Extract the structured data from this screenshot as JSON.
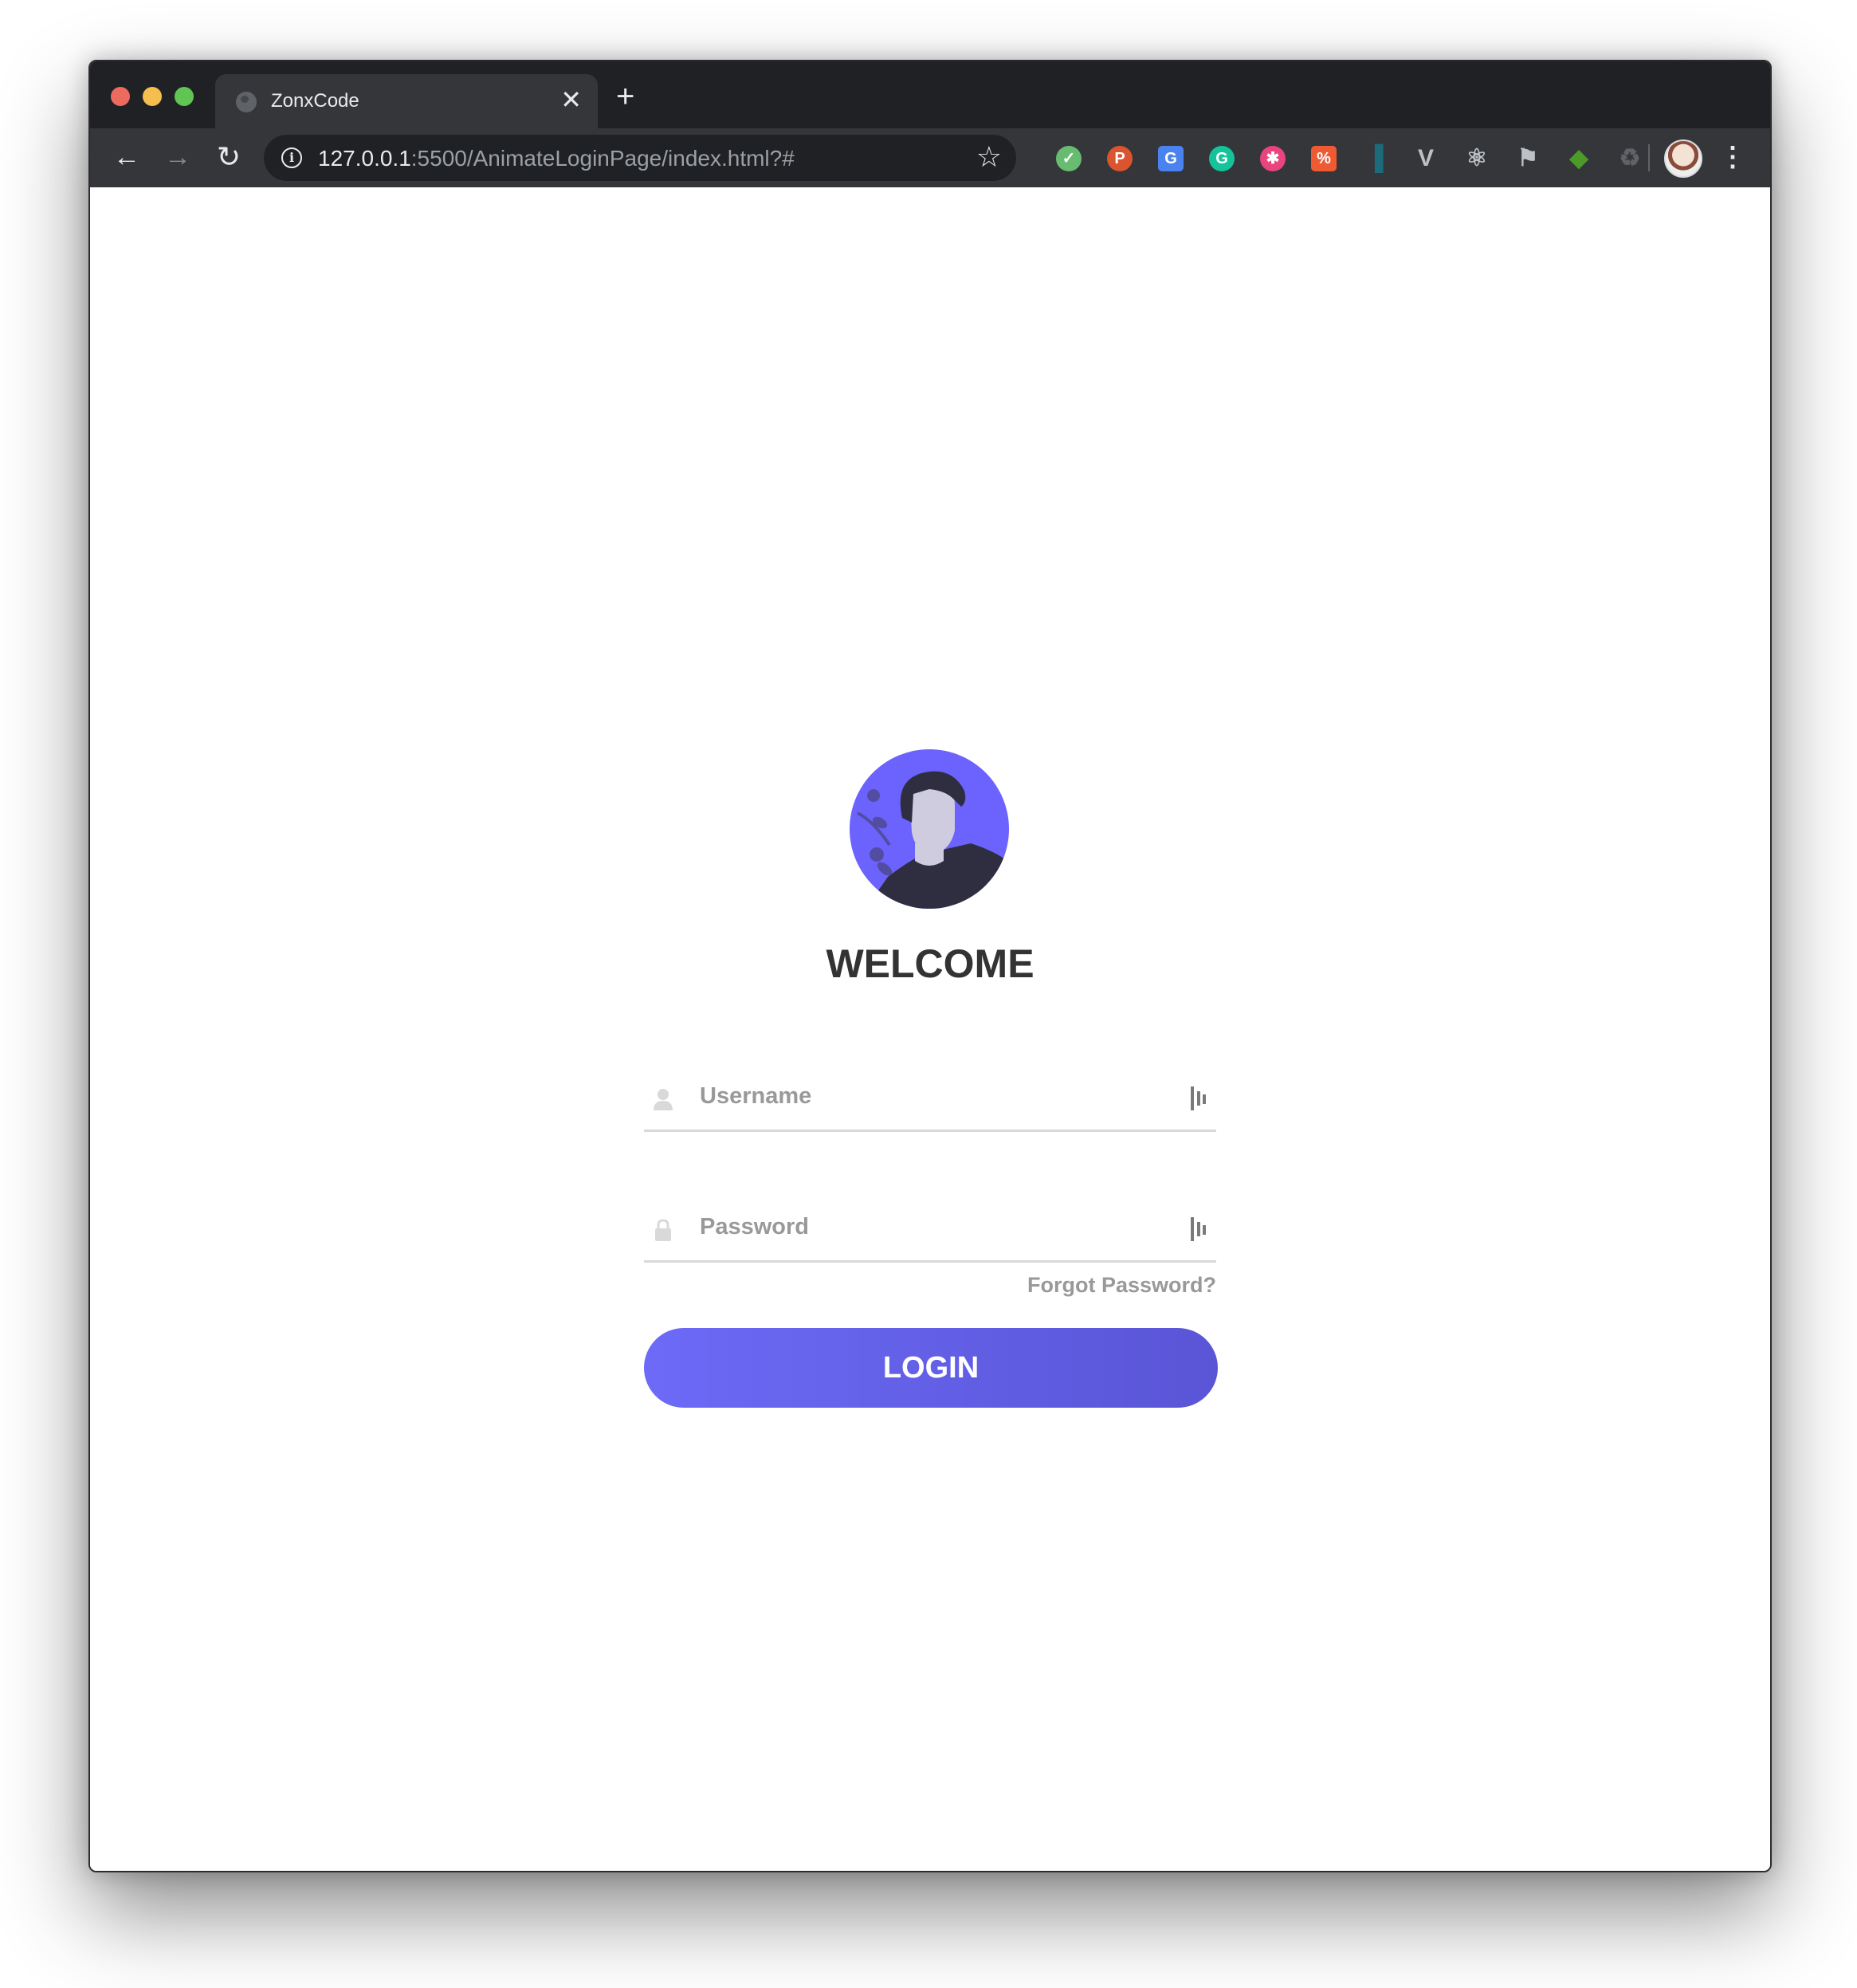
{
  "browser": {
    "tab": {
      "title": "ZonxCode",
      "close_glyph": "✕",
      "favicon": "globe-icon"
    },
    "new_tab_glyph": "+",
    "nav": {
      "back_glyph": "←",
      "forward_glyph": "→",
      "reload_glyph": "↻"
    },
    "address": {
      "host": "127.0.0.1",
      "rest": ":5500/AnimateLoginPage/index.html?#"
    },
    "extensions": [
      {
        "name": "adguard-shield-icon",
        "glyph": "✓",
        "color": "#68bc71"
      },
      {
        "name": "producthunt-icon",
        "glyph": "P",
        "color": "#da552f"
      },
      {
        "name": "google-translate-icon",
        "glyph": "G",
        "color": "#4a83f0"
      },
      {
        "name": "grammarly-icon",
        "glyph": "G",
        "color": "#15c39a"
      },
      {
        "name": "asterisk-extension-icon",
        "glyph": "✱",
        "color": "#e8457c"
      },
      {
        "name": "percent-extension-icon",
        "glyph": "%",
        "color": "#ef5a33"
      },
      {
        "name": "dashlane-icon",
        "glyph": "▐",
        "color": "#1c6b7a"
      },
      {
        "name": "vue-devtools-icon",
        "glyph": "V",
        "color": "#bdc1c6"
      },
      {
        "name": "react-devtools-icon",
        "glyph": "⚛",
        "color": "#bdc1c6"
      },
      {
        "name": "flag-icon",
        "glyph": "⚑",
        "color": "#bdc1c6"
      },
      {
        "name": "cube-extension-icon",
        "glyph": "◆",
        "color": "#4c9a2a"
      },
      {
        "name": "recycle-icon",
        "glyph": "♻",
        "color": "#5f6368"
      }
    ],
    "menu_glyph": "⋮"
  },
  "login": {
    "heading": "WELCOME",
    "username_placeholder": "Username",
    "password_placeholder": "Password",
    "forgot_label": "Forgot Password?",
    "login_label": "LOGIN"
  },
  "colors": {
    "accent_start": "#6c6af7",
    "accent_end": "#5a55d6",
    "heading": "#333333",
    "muted": "#999999"
  }
}
